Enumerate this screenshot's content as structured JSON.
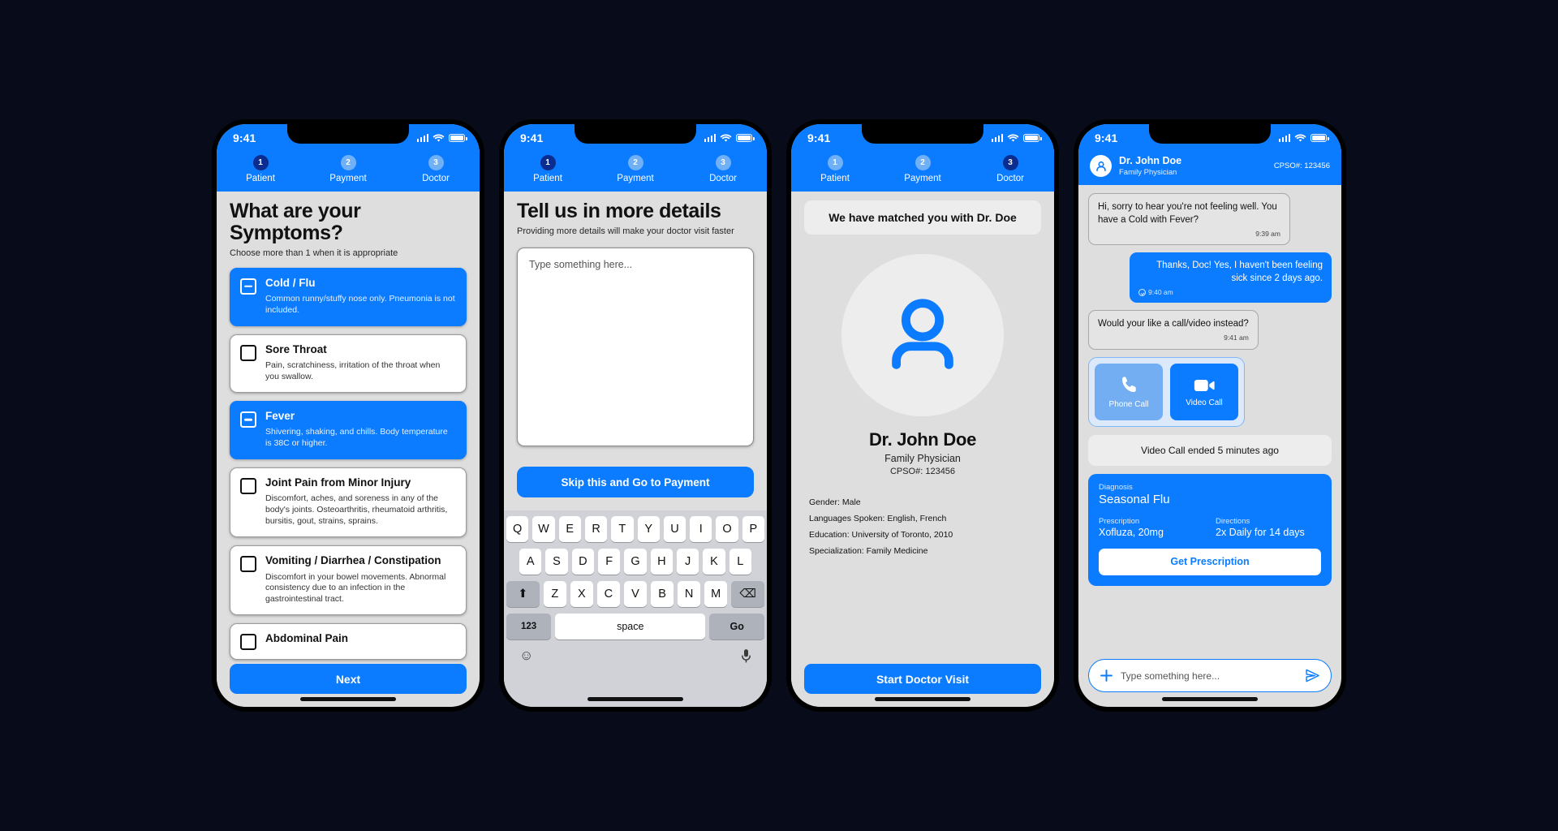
{
  "status_bar": {
    "time": "9:41"
  },
  "stepper": {
    "steps": [
      {
        "num": "1",
        "label": "Patient"
      },
      {
        "num": "2",
        "label": "Payment"
      },
      {
        "num": "3",
        "label": "Doctor"
      }
    ]
  },
  "screen1": {
    "title": "What are your Symptoms?",
    "subtitle": "Choose more than 1 when it is appropriate",
    "next_label": "Next",
    "symptoms": [
      {
        "title": "Cold / Flu",
        "desc": "Common runny/stuffy nose only. Pneumonia is not included.",
        "selected": true
      },
      {
        "title": "Sore Throat",
        "desc": "Pain, scratchiness, irritation of the throat when you swallow.",
        "selected": false
      },
      {
        "title": "Fever",
        "desc": "Shivering, shaking, and chills. Body temperature is 38C or higher.",
        "selected": true
      },
      {
        "title": "Joint Pain from Minor Injury",
        "desc": "Discomfort, aches, and soreness in any of the body's joints. Osteoarthritis, rheumatoid arthritis, bursitis, gout, strains, sprains.",
        "selected": false
      },
      {
        "title": "Vomiting / Diarrhea / Constipation",
        "desc": "Discomfort in your bowel movements. Abnormal consistency due to an infection in the gastrointestinal tract.",
        "selected": false
      },
      {
        "title": "Abdominal Pain",
        "desc": "",
        "selected": false
      }
    ]
  },
  "screen2": {
    "title": "Tell us in more details",
    "subtitle": "Providing more details will make your doctor visit faster",
    "textarea_placeholder": "Type something here...",
    "textarea_value": "",
    "skip_label": "Skip this and Go to Payment",
    "keyboard": {
      "row1": [
        "Q",
        "W",
        "E",
        "R",
        "T",
        "Y",
        "U",
        "I",
        "O",
        "P"
      ],
      "row2": [
        "A",
        "S",
        "D",
        "F",
        "G",
        "H",
        "J",
        "K",
        "L"
      ],
      "row3": [
        "Z",
        "X",
        "C",
        "V",
        "B",
        "N",
        "M"
      ],
      "shift_label": "⬆",
      "backspace_label": "⌫",
      "numeric_label": "123",
      "space_label": "space",
      "go_label": "Go",
      "emoji_label": "☺",
      "mic_label": "mic"
    }
  },
  "screen3": {
    "match_banner": "We have matched you with Dr. Doe",
    "doctor_name": "Dr. John Doe",
    "doctor_role": "Family Physician",
    "doctor_cpso": "CPSO#: 123456",
    "facts": [
      "Gender: Male",
      "Languages Spoken: English, French",
      "Education: University of Toronto, 2010",
      "Specialization: Family Medicine"
    ],
    "start_label": "Start Doctor Visit"
  },
  "screen4": {
    "header": {
      "name": "Dr. John Doe",
      "role": "Family Physician",
      "cpso": "CPSO#: 123456"
    },
    "messages": [
      {
        "from": "them",
        "text": "Hi, sorry to hear you're not feeling well. You have a Cold with Fever?",
        "time": "9:39 am"
      },
      {
        "from": "me",
        "text": "Thanks, Doc! Yes, I haven't been feeling sick since 2 days ago.",
        "time": "9:40 am"
      },
      {
        "from": "them",
        "text": "Would your like a call/video instead?",
        "time": "9:41 am"
      }
    ],
    "call_options": [
      {
        "label": "Phone Call",
        "icon": "phone-icon",
        "style": "muted"
      },
      {
        "label": "Video Call",
        "icon": "video-icon",
        "style": "solid"
      }
    ],
    "system_note": "Video Call ended 5 minutes ago",
    "diagnosis": {
      "diagnosis_label": "Diagnosis",
      "diagnosis_value": "Seasonal Flu",
      "prescription_label": "Prescription",
      "prescription_value": "Xofluza, 20mg",
      "directions_label": "Directions",
      "directions_value": "2x Daily for 14 days",
      "action_label": "Get Prescription"
    },
    "composer_placeholder": "Type something here..."
  },
  "colors": {
    "brand": "#0b7bff",
    "active_step": "#0a2d8f",
    "muted_blue": "#74aef2",
    "screen_bg": "#dedede"
  }
}
